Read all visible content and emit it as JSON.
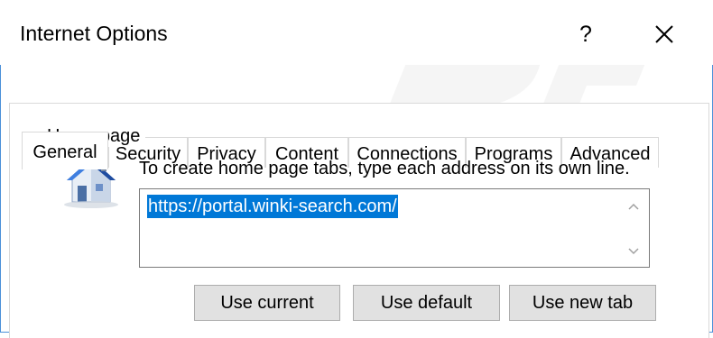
{
  "window": {
    "title": "Internet Options",
    "help_label": "?"
  },
  "tabs": [
    {
      "label": "General",
      "active": true
    },
    {
      "label": "Security",
      "active": false
    },
    {
      "label": "Privacy",
      "active": false
    },
    {
      "label": "Content",
      "active": false
    },
    {
      "label": "Connections",
      "active": false
    },
    {
      "label": "Programs",
      "active": false
    },
    {
      "label": "Advanced",
      "active": false
    }
  ],
  "home_page": {
    "group_label": "Home page",
    "instruction": "To create home page tabs, type each address on its own line.",
    "address_value": "https://portal.winki-search.com/",
    "buttons": {
      "use_current": "Use current",
      "use_default": "Use default",
      "use_new_tab": "Use new tab"
    }
  },
  "icons": {
    "close": "close-icon",
    "house": "house-icon",
    "scroll_up": "chevron-up-icon",
    "scroll_down": "chevron-down-icon"
  },
  "colors": {
    "selection": "#0078d7",
    "border_accent": "#4a90d9",
    "button_face": "#e1e1e1"
  }
}
